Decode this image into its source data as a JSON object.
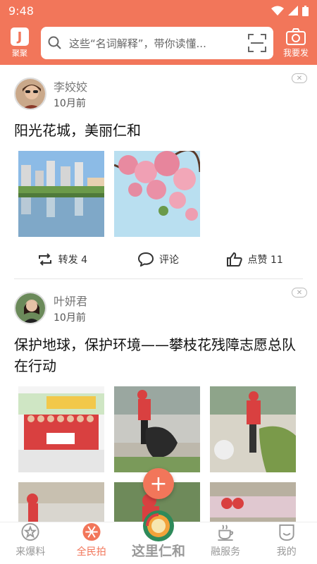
{
  "status_bar": {
    "time": "9:48"
  },
  "header": {
    "logo_label": "聚聚",
    "logo_glyph": "J",
    "search_placeholder": "这些“名词解释”，带你读懂...",
    "post_label": "我要发",
    "accent_color": "#f2765a"
  },
  "posts": [
    {
      "author": "李姣姣",
      "time": "10月前",
      "title": "阳光花城，美丽仁和",
      "actions": {
        "repost": "转发 4",
        "comment": "评论",
        "like": "点赞 11"
      }
    },
    {
      "author": "叶妍君",
      "time": "10月前",
      "title": "保护地球，保护环境——攀枝花残障志愿总队在行动"
    }
  ],
  "fab": {
    "label": "+"
  },
  "tabbar": {
    "tabs": [
      {
        "label": "来爆料",
        "icon": "star-icon"
      },
      {
        "label": "全民拍",
        "icon": "aperture-icon",
        "active": true
      },
      {
        "label": "这里仁和",
        "icon": "city-logo-icon"
      },
      {
        "label": "融服务",
        "icon": "coffee-icon"
      },
      {
        "label": "我的",
        "icon": "smile-icon"
      }
    ]
  }
}
